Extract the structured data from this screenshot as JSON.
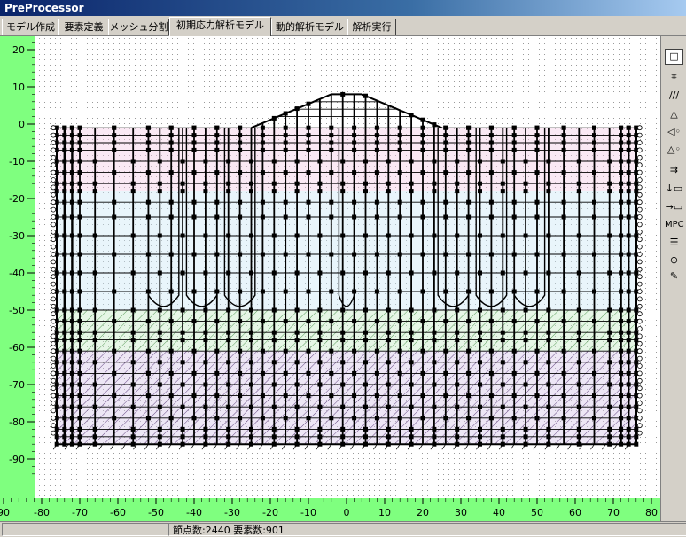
{
  "window": {
    "title": "PreProcessor"
  },
  "tabs": [
    {
      "label": "モデル作成"
    },
    {
      "label": "要素定義"
    },
    {
      "label": "メッシュ分割"
    },
    {
      "label": "初期応力解析モデル"
    },
    {
      "label": "動的解析モデル"
    },
    {
      "label": "解析実行"
    }
  ],
  "active_tab": 3,
  "plot": {
    "y_ticks": [
      "20",
      "10",
      "0",
      "-10",
      "-20",
      "-30",
      "-40",
      "-50",
      "-60",
      "-70",
      "-80",
      "-90"
    ],
    "x_ticks": [
      "90",
      "-80",
      "-70",
      "-60",
      "-50",
      "-40",
      "-30",
      "-20",
      "-10",
      "0",
      "10",
      "20",
      "30",
      "40",
      "50",
      "60",
      "70",
      "80"
    ],
    "colors": {
      "axis_bar": "#7fff7f",
      "mesh": "#000000",
      "layer_pink": "#f3cfe6",
      "layer_blue": "#cfe8f7",
      "layer_green": "#c8ecc8",
      "layer_purple": "#d8c8e8"
    }
  },
  "toolbar": {
    "tools": [
      "select-rect-icon",
      "node-icon",
      "fixed-support-icon",
      "triangle-icon",
      "roller-x-icon",
      "roller-y-icon",
      "load-icon",
      "load-down-icon",
      "load-side-icon",
      "MPC",
      "spring-icon",
      "joint-icon",
      "edit-icon"
    ],
    "mpc_label": "MPC"
  },
  "status": {
    "text": "節点数:2440 要素数:901"
  }
}
